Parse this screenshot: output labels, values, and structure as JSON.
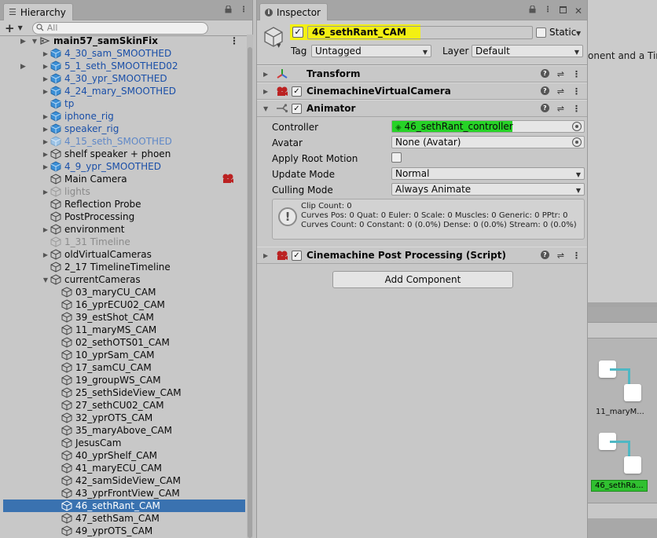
{
  "background": {
    "scene_text": "onent and a Time",
    "graph_nodes": [
      {
        "label": "11_maryM...",
        "selected": false
      },
      {
        "label": "46_sethRa...",
        "selected": true
      }
    ],
    "colors": {
      "link": "#4fb7c3",
      "selected_node": "#30c030"
    }
  },
  "hierarchy": {
    "tab_title": "Hierarchy",
    "add_label": "+",
    "search_placeholder": "All",
    "items": [
      {
        "label": "main57_samSkinFix",
        "type": "scene",
        "expanded": true
      },
      {
        "label": "4_30_sam_SMOOTHED",
        "type": "prefab",
        "collapsed": true
      },
      {
        "label": "5_1_seth_SMOOTHED02",
        "type": "prefab",
        "collapsed": true
      },
      {
        "label": "4_30_ypr_SMOOTHED",
        "type": "prefab",
        "collapsed": true
      },
      {
        "label": "4_24_mary_SMOOTHED",
        "type": "prefab",
        "collapsed": true
      },
      {
        "label": "tp",
        "type": "prefab"
      },
      {
        "label": "iphone_rig",
        "type": "prefab",
        "collapsed": true
      },
      {
        "label": "speaker_rig",
        "type": "prefab",
        "collapsed": true
      },
      {
        "label": "4_15_seth_SMOOTHED",
        "type": "prefab-dim",
        "collapsed": true
      },
      {
        "label": "shelf speaker + phoen",
        "type": "object",
        "collapsed": true
      },
      {
        "label": "4_9_ypr_SMOOTHED",
        "type": "prefab",
        "collapsed": true
      },
      {
        "label": "Main Camera",
        "type": "object",
        "badge": true
      },
      {
        "label": "lights",
        "type": "dim",
        "collapsed": true
      },
      {
        "label": "Reflection Probe",
        "type": "object"
      },
      {
        "label": "PostProcessing",
        "type": "object"
      },
      {
        "label": "environment",
        "type": "object",
        "collapsed": true
      },
      {
        "label": "1_31 Timeline",
        "type": "dim"
      },
      {
        "label": "oldVirtualCameras",
        "type": "object",
        "collapsed": true
      },
      {
        "label": "2_17 TimelineTimeline",
        "type": "object"
      },
      {
        "label": "currentCameras",
        "type": "object",
        "expanded": true
      },
      {
        "label": "03_maryCU_CAM",
        "type": "child"
      },
      {
        "label": "16_yprECU02_CAM",
        "type": "child"
      },
      {
        "label": "39_estShot_CAM",
        "type": "child"
      },
      {
        "label": "11_maryMS_CAM",
        "type": "child"
      },
      {
        "label": "02_sethOTS01_CAM",
        "type": "child"
      },
      {
        "label": "10_yprSam_CAM",
        "type": "child"
      },
      {
        "label": "17_samCU_CAM",
        "type": "child"
      },
      {
        "label": "19_groupWS_CAM",
        "type": "child"
      },
      {
        "label": "25_sethSideView_CAM",
        "type": "child"
      },
      {
        "label": "27_sethCU02_CAM",
        "type": "child"
      },
      {
        "label": "32_yprOTS_CAM",
        "type": "child"
      },
      {
        "label": "35_maryAbove_CAM",
        "type": "child"
      },
      {
        "label": "JesusCam",
        "type": "child"
      },
      {
        "label": "40_yprShelf_CAM",
        "type": "child"
      },
      {
        "label": "41_maryECU_CAM",
        "type": "child"
      },
      {
        "label": "42_samSideView_CAM",
        "type": "child"
      },
      {
        "label": "43_yprFrontView_CAM",
        "type": "child"
      },
      {
        "label": "46_sethRant_CAM",
        "type": "child",
        "selected": true
      },
      {
        "label": "47_sethSam_CAM",
        "type": "child"
      },
      {
        "label": "49_yprOTS_CAM",
        "type": "child"
      }
    ]
  },
  "inspector": {
    "tab_title": "Inspector",
    "object_name": "46_sethRant_CAM",
    "static_label": "Static",
    "tag_label": "Tag",
    "tag_value": "Untagged",
    "layer_label": "Layer",
    "layer_value": "Default",
    "components": [
      {
        "title": "Transform"
      },
      {
        "title": "CinemachineVirtualCamera"
      },
      {
        "title": "Animator"
      },
      {
        "title": "Cinemachine Post Processing (Script)"
      }
    ],
    "animator": {
      "controller_label": "Controller",
      "controller_value": "46_sethRant_controller",
      "avatar_label": "Avatar",
      "avatar_value": "None (Avatar)",
      "root_motion_label": "Apply Root Motion",
      "update_mode_label": "Update Mode",
      "update_mode_value": "Normal",
      "culling_mode_label": "Culling Mode",
      "culling_mode_value": "Always Animate",
      "info_lines": [
        "Clip Count: 0",
        "Curves Pos: 0 Quat: 0 Euler: 0 Scale: 0 Muscles: 0 Generic: 0 PPtr: 0",
        "Curves Count: 0 Constant: 0 (0.0%) Dense: 0 (0.0%) Stream: 0 (0.0%)"
      ]
    },
    "add_component_label": "Add Component",
    "colors": {
      "name_highlight": "#f3f012",
      "controller_highlight": "#27d327"
    }
  }
}
